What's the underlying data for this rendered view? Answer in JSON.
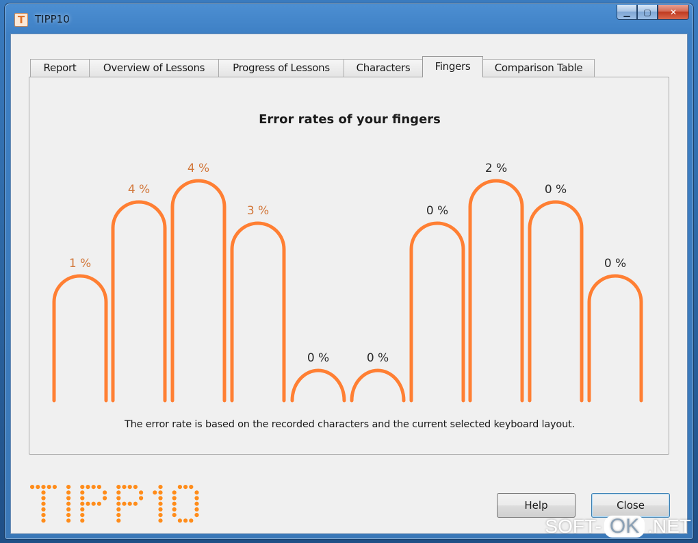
{
  "window": {
    "title": "TIPP10",
    "icon_letter": "T",
    "caption_minimize": "▁",
    "caption_maximize": "▢",
    "caption_close": "✕"
  },
  "tabs": [
    {
      "label": "Report",
      "active": false
    },
    {
      "label": "Overview of Lessons",
      "active": false
    },
    {
      "label": "Progress of Lessons",
      "active": false
    },
    {
      "label": "Characters",
      "active": false
    },
    {
      "label": "Fingers",
      "active": true
    },
    {
      "label": "Comparison Table",
      "active": false
    }
  ],
  "chart_data": {
    "type": "bar",
    "title": "Error rates of your fingers",
    "categories": [],
    "values": [
      1,
      4,
      4,
      3,
      0,
      0,
      0,
      2,
      0,
      0
    ],
    "value_labels": [
      "1 %",
      "4 %",
      "4 %",
      "3 %",
      "0 %",
      "0 %",
      "0 %",
      "2 %",
      "0 %",
      "0 %"
    ],
    "xlabel": "",
    "ylabel": "",
    "grid": false,
    "colors": {
      "arch": "#ff7f33",
      "label_highlight": "#d2773a",
      "label_normal": "#2a2a2a"
    }
  },
  "footnote": "The error rate is based on the recorded characters and the current selected keyboard layout.",
  "logo": {
    "text": "TIPP10",
    "color": "#ff8c1a"
  },
  "buttons": {
    "help": "Help",
    "close": "Close"
  },
  "watermark": {
    "left": "SOFT-",
    "middle": "OK",
    "right": ".NET"
  }
}
